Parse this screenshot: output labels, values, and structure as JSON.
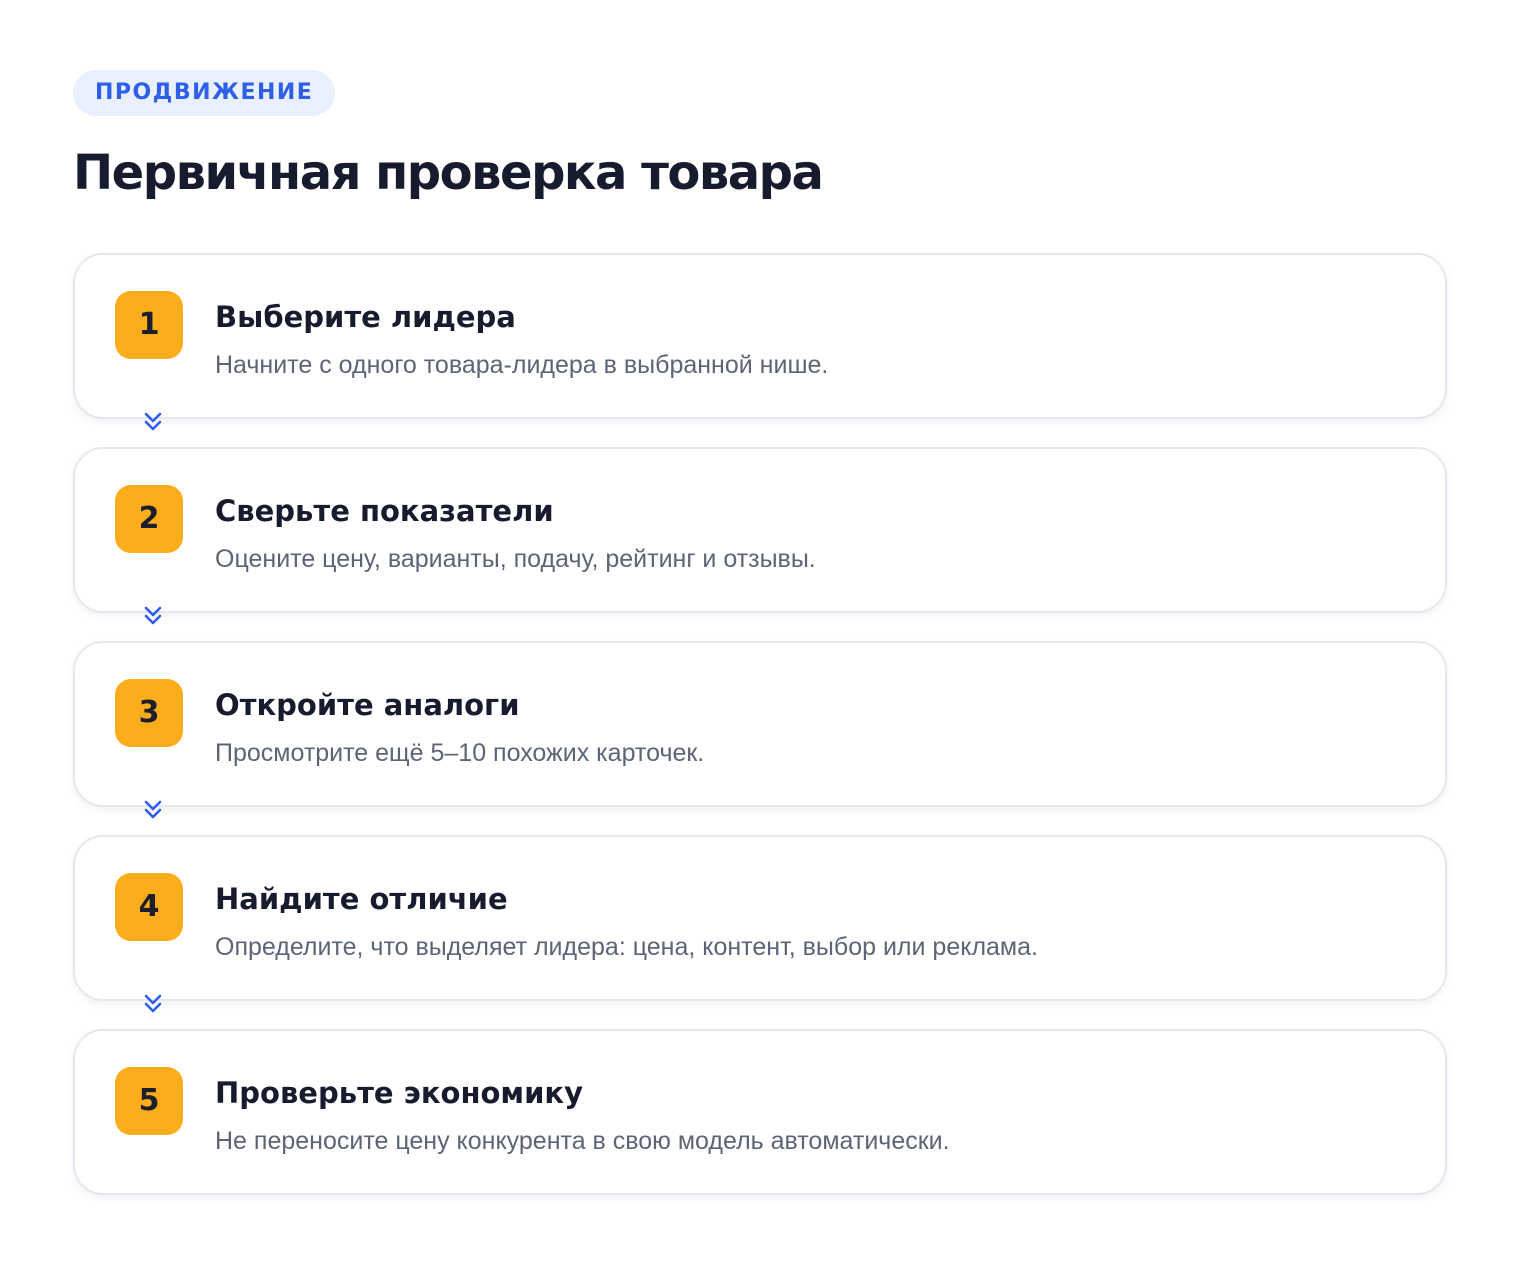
{
  "tag": "ПРОДВИЖЕНИЕ",
  "title": "Первичная проверка товара",
  "colors": {
    "accent_blue": "#2f5ee8",
    "tag_bg": "#e8effd",
    "number_badge": "#fdad1c",
    "title_text": "#161b2e",
    "desc_text": "#5c6475",
    "card_border": "#e6e8ef"
  },
  "connector_icon": "double-chevron-down-icon",
  "steps": [
    {
      "number": "1",
      "title": "Выберите лидера",
      "description": "Начните с одного товара-лидера в выбранной нише."
    },
    {
      "number": "2",
      "title": "Сверьте показатели",
      "description": "Оцените цену, варианты, подачу, рейтинг и отзывы."
    },
    {
      "number": "3",
      "title": "Откройте аналоги",
      "description": "Просмотрите ещё 5–10 похожих карточек."
    },
    {
      "number": "4",
      "title": "Найдите отличие",
      "description": "Определите, что выделяет лидера: цена, контент, выбор или реклама."
    },
    {
      "number": "5",
      "title": "Проверьте экономику",
      "description": "Не переносите цену конкурента в свою модель автоматически."
    }
  ]
}
